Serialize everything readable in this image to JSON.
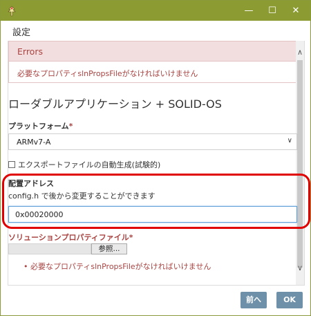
{
  "window": {
    "title": "",
    "min_glyph": "—",
    "max_glyph": "☐",
    "close_glyph": "✕",
    "titlebar_color": "#8c9c33",
    "app_icon": "app-logo-icon"
  },
  "dialog": {
    "title": "設定"
  },
  "errors": {
    "header": "Errors",
    "message": "必要なプロパティslnPropsFileがなければいけません",
    "color": "#a94442"
  },
  "app_title": "ローダブルアプリケーション + SOLID-OS",
  "platform": {
    "label": "プラットフォーム",
    "required_mark": "*",
    "selected": "ARMv7-A",
    "arrow": "∨"
  },
  "export": {
    "label": "エクスポートファイルの自動生成(試験的)"
  },
  "address": {
    "label": "配置アドレス",
    "help": "config.h で後から変更することができます",
    "value": "0x00020000"
  },
  "solution_file": {
    "label": "ソリューションプロパティファイル",
    "required_mark": "*",
    "browse_label": "参照...",
    "error": "必要なプロパティslnPropsFileがなければいけません"
  },
  "scrollbar": {
    "up": "∧",
    "down": "∨"
  },
  "footer": {
    "prev_label": "前へ",
    "ok_label": "OK",
    "button_color": "#6e90a8"
  },
  "highlight_color": "#e00000"
}
